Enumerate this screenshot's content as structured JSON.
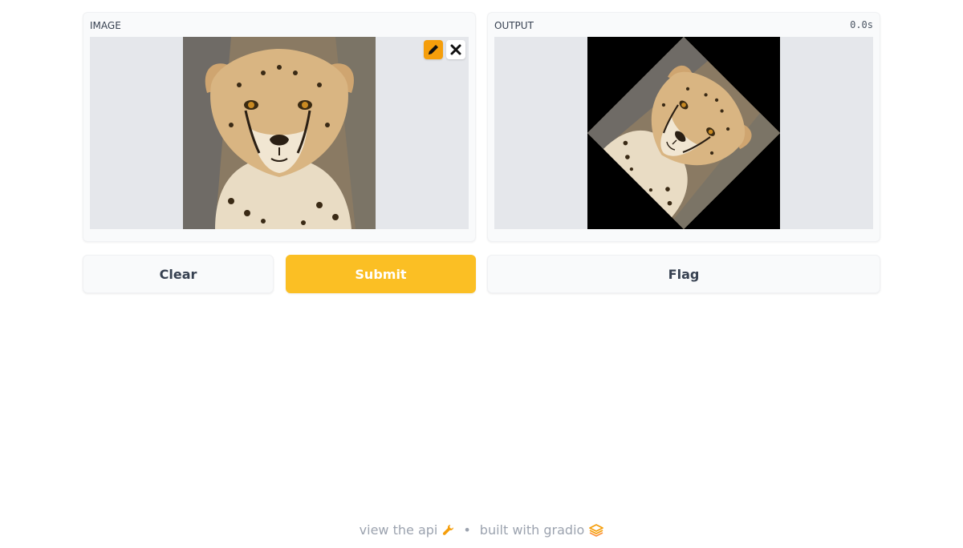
{
  "input": {
    "label": "IMAGE",
    "image_alt": "cheetah"
  },
  "output": {
    "label": "OUTPUT",
    "timer": "0.0s",
    "image_alt": "cheetah rotated"
  },
  "buttons": {
    "clear": "Clear",
    "submit": "Submit",
    "flag": "Flag"
  },
  "footer": {
    "api_link": "view the api",
    "separator": "•",
    "built_with": "built with gradio"
  },
  "colors": {
    "accent": "#f59e0b",
    "submit": "#fbbf24"
  },
  "icons": {
    "edit": "pencil-icon",
    "remove": "close-icon",
    "api": "wrench-icon",
    "brand": "gradio-logo-icon"
  }
}
